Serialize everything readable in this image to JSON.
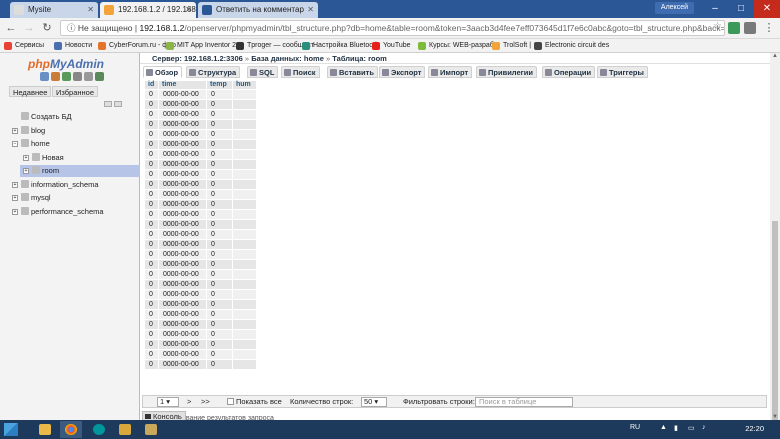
{
  "browser": {
    "tabs": [
      {
        "title": "Mysite",
        "favicon_color": "#f2f2f2"
      },
      {
        "title": "192.168.1.2 / 192.168.1.2",
        "favicon_color": "#f2a33a"
      },
      {
        "title": "Ответить на комментар",
        "favicon_color": "#2b5797"
      }
    ],
    "user": "Алексей",
    "window_controls": {
      "minimize": "–",
      "maximize": "□",
      "close": "✕"
    },
    "security_label": "Не защищено",
    "url_host": "192.168.1.2",
    "url_path": "/openserver/phpmyadmin/tbl_structure.php?db=home&table=room&token=3aacb3d4fee7eff073645d1f7e6c0abc&goto=tbl_structure.php&back=tbl...",
    "bookmarks": [
      {
        "label": "Сервисы",
        "color": "#e94235"
      },
      {
        "label": "Новости",
        "color": "#4b6fae"
      },
      {
        "label": "CyberForum.ru - фор",
        "color": "#e3742a"
      },
      {
        "label": "MIT App Inventor 2",
        "color": "#8bb545"
      },
      {
        "label": "Tproger — сообщест",
        "color": "#333333"
      },
      {
        "label": "Настройка Bluetooth",
        "color": "#2a8f7a"
      },
      {
        "label": "YouTube",
        "color": "#e62117"
      },
      {
        "label": "Курсы: WEB-разраб",
        "color": "#7cba3a"
      },
      {
        "label": "TrolSoft |",
        "color": "#f2a33a"
      },
      {
        "label": "Electronic circuit des",
        "color": "#444444"
      }
    ]
  },
  "sidebar": {
    "logo_php": "php",
    "logo_myadmin": "MyAdmin",
    "recent_label": "Недавнее",
    "favorites_label": "Избранное",
    "tree": [
      {
        "label": "Создать БД",
        "level": 0
      },
      {
        "label": "blog",
        "level": 0
      },
      {
        "label": "home",
        "level": 0
      },
      {
        "label": "Новая",
        "level": 1
      },
      {
        "label": "room",
        "level": 1,
        "selected": true
      },
      {
        "label": "information_schema",
        "level": 0
      },
      {
        "label": "mysql",
        "level": 0
      },
      {
        "label": "performance_schema",
        "level": 0
      }
    ]
  },
  "breadcrumb": {
    "server": "Сервер: 192.168.1.2:3306",
    "database": "База данных: home",
    "table": "Таблица: room",
    "separator": "»"
  },
  "menu": [
    "Обзор",
    "Структура",
    "SQL",
    "Поиск",
    "Вставить",
    "Экспорт",
    "Импорт",
    "Привилегии",
    "Операции",
    "Триггеры"
  ],
  "table": {
    "columns": [
      "id",
      "time",
      "temp",
      "hum"
    ],
    "row_values": [
      "0",
      "0000-00-00",
      "0",
      ""
    ],
    "row_count": 28
  },
  "pagination": {
    "page": "1",
    "next": ">",
    "last": ">>",
    "show_all": "Показать все",
    "rows_label": "Количество строк:",
    "rows_value": "50",
    "filter_label": "Фильтровать строки:",
    "filter_placeholder": "Поиск в таблице"
  },
  "console": {
    "label": "Консоль",
    "behind_text": "...вание результатов запроса"
  },
  "taskbar": {
    "lang": "RU",
    "time": "22:20"
  }
}
